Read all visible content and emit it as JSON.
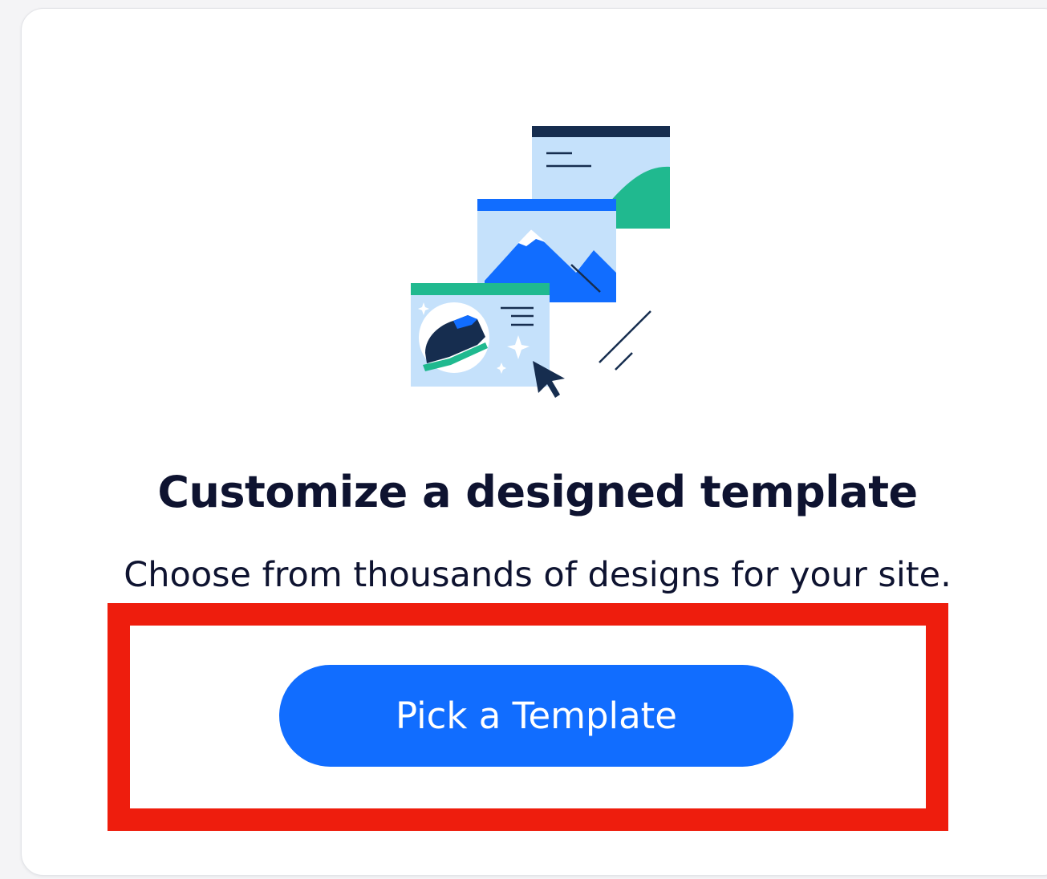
{
  "card": {
    "title": "Customize a designed template",
    "subtitle": "Choose from thousands of designs for your site.",
    "button_label": "Pick a Template"
  },
  "illustration": {
    "icon": "template-windows-illustration"
  },
  "colors": {
    "accent": "#116dff",
    "title_text": "#0e1330",
    "highlight": "#ee1d0d",
    "green": "#20b98f",
    "light_blue": "#c5e1fb",
    "navy": "#162d4f"
  }
}
